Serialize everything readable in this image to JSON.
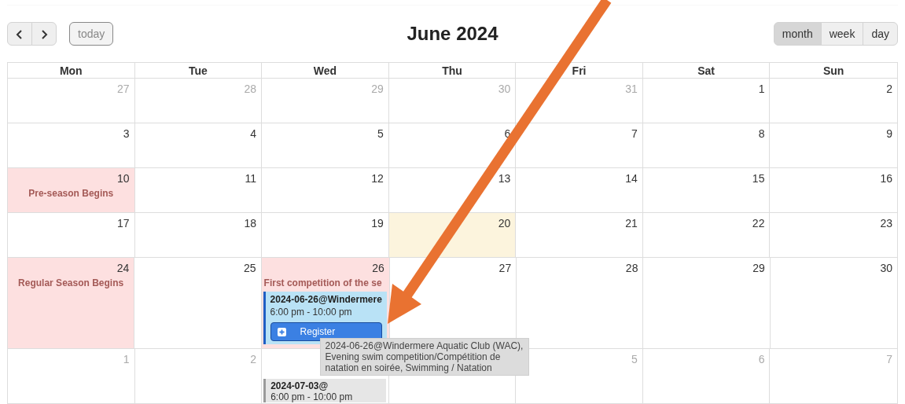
{
  "toolbar": {
    "today": {
      "label": "today",
      "disabled": true
    }
  },
  "title": "June 2024",
  "views": [
    {
      "label": "month",
      "selected": true
    },
    {
      "label": "week",
      "selected": false
    },
    {
      "label": "day",
      "selected": false
    }
  ],
  "weekdays": [
    "Mon",
    "Tue",
    "Wed",
    "Thu",
    "Fri",
    "Sat",
    "Sun"
  ],
  "weeks": [
    [
      {
        "day": "27",
        "other_month": true
      },
      {
        "day": "28",
        "other_month": true
      },
      {
        "day": "29",
        "other_month": true
      },
      {
        "day": "30",
        "other_month": true
      },
      {
        "day": "31",
        "other_month": true
      },
      {
        "day": "1",
        "other_month": false
      },
      {
        "day": "2",
        "other_month": false
      }
    ],
    [
      {
        "day": "3",
        "other_month": false
      },
      {
        "day": "4",
        "other_month": false
      },
      {
        "day": "5",
        "other_month": false
      },
      {
        "day": "6",
        "other_month": false
      },
      {
        "day": "7",
        "other_month": false
      },
      {
        "day": "8",
        "other_month": false
      },
      {
        "day": "9",
        "other_month": false
      }
    ],
    [
      {
        "day": "10",
        "other_month": false,
        "background_event": "Pre-season Begins"
      },
      {
        "day": "11",
        "other_month": false
      },
      {
        "day": "12",
        "other_month": false
      },
      {
        "day": "13",
        "other_month": false
      },
      {
        "day": "14",
        "other_month": false
      },
      {
        "day": "15",
        "other_month": false
      },
      {
        "day": "16",
        "other_month": false
      }
    ],
    [
      {
        "day": "17",
        "other_month": false
      },
      {
        "day": "18",
        "other_month": false
      },
      {
        "day": "19",
        "other_month": false
      },
      {
        "day": "20",
        "other_month": false,
        "today": true
      },
      {
        "day": "21",
        "other_month": false
      },
      {
        "day": "22",
        "other_month": false
      },
      {
        "day": "23",
        "other_month": false
      }
    ],
    [
      {
        "day": "24",
        "other_month": false,
        "background_event": "Regular Season Begins"
      },
      {
        "day": "25",
        "other_month": false
      },
      {
        "day": "26",
        "other_month": false,
        "background_event": "First competition of the se",
        "events": [
          {
            "kind": "open",
            "title": "2024-06-26@Windermere",
            "time": "6:00 pm - 10:00 pm",
            "button": "Register",
            "tooltip": "2024-06-26@Windermere Aquatic Club (WAC), Evening swim competition/Compétition de natation en soirée, Swimming / Natation"
          }
        ]
      },
      {
        "day": "27",
        "other_month": false
      },
      {
        "day": "28",
        "other_month": false
      },
      {
        "day": "29",
        "other_month": false
      },
      {
        "day": "30",
        "other_month": false
      }
    ],
    [
      {
        "day": "1",
        "other_month": true
      },
      {
        "day": "2",
        "other_month": true
      },
      {
        "events": [
          {
            "kind": "closed",
            "title": "2024-07-03@",
            "time": "6:00 pm - 10:00 pm"
          }
        ]
      },
      {
        "day": "5",
        "other_month": true
      },
      {
        "day": "6",
        "other_month": true
      },
      {
        "day": "7",
        "other_month": true
      }
    ]
  ]
}
